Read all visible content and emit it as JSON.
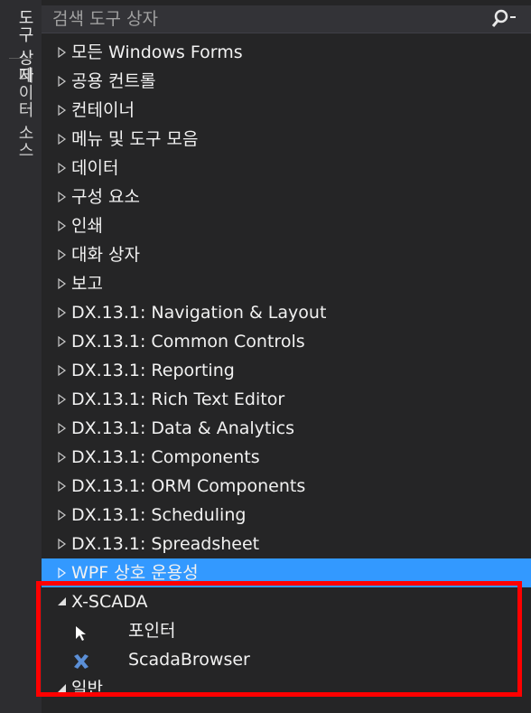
{
  "side_tabs": {
    "toolbox": "도구 상자",
    "datasource": "데이터 소스"
  },
  "search": {
    "placeholder": "검색 도구 상자"
  },
  "tree": {
    "groups": [
      "모든 Windows Forms",
      "공용 컨트롤",
      "컨테이너",
      "메뉴 및 도구 모음",
      "데이터",
      "구성 요소",
      "인쇄",
      "대화 상자",
      "보고",
      "DX.13.1: Navigation & Layout",
      "DX.13.1: Common Controls",
      "DX.13.1: Reporting",
      "DX.13.1: Rich Text Editor",
      "DX.13.1: Data & Analytics",
      "DX.13.1: Components",
      "DX.13.1: ORM Components",
      "DX.13.1: Scheduling",
      "DX.13.1: Spreadsheet",
      "WPF 상호 운용성"
    ],
    "xscada": {
      "label": "X-SCADA",
      "items": [
        "포인터",
        "ScadaBrowser"
      ]
    },
    "general": "일반"
  },
  "colors": {
    "selected": "#3399ff",
    "highlight": "#ff0000"
  }
}
